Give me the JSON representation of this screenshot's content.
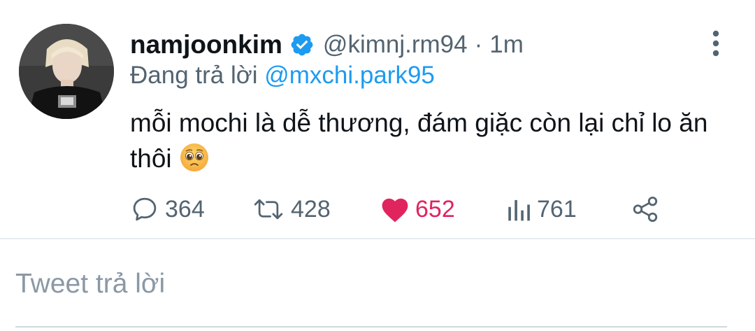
{
  "tweet": {
    "author": {
      "name": "namjoonkim",
      "handle": "@kimnj.rm94",
      "verified": true,
      "avatar": "avatar-photo"
    },
    "separator": "·",
    "time": "1m",
    "replying_prefix": "Đang trả lời",
    "replying_to": "@mxchi.park95",
    "text": "mỗi mochi là dễ thương, đám giặc còn lại chỉ lo ăn thôi",
    "emoji": "pleading-face",
    "stats": {
      "replies": "364",
      "retweets": "428",
      "likes": "652",
      "views": "761"
    },
    "icons": {
      "reply": "comment-icon",
      "retweet": "retweet-icon",
      "like": "heart-icon",
      "views": "views-chart-icon",
      "share": "share-icon",
      "more": "more-vertical-icon"
    }
  },
  "reply_box": {
    "placeholder": "Tweet trả lời"
  },
  "colors": {
    "accent": "#1d9bf0",
    "like": "#e0245e",
    "secondary_text": "#536471",
    "primary_text": "#0f1419"
  }
}
